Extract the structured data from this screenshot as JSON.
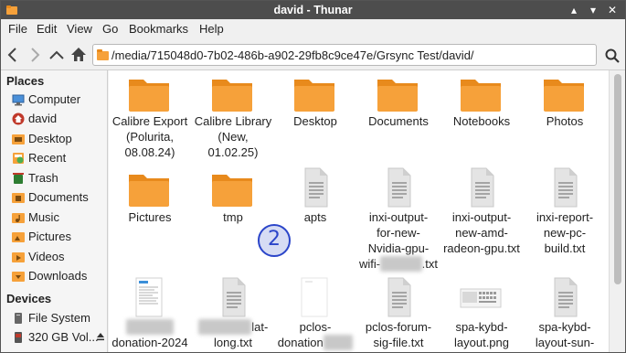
{
  "window": {
    "title": "david - Thunar"
  },
  "menubar": {
    "items": [
      "File",
      "Edit",
      "View",
      "Go",
      "Bookmarks",
      "Help"
    ]
  },
  "location": {
    "path": "/media/715048d0-7b02-486b-a902-29fb8c9ce47e/Grsync Test/david/"
  },
  "sidebar": {
    "places_header": "Places",
    "places": [
      {
        "label": "Computer",
        "icon": "computer-icon"
      },
      {
        "label": "david",
        "icon": "home-icon"
      },
      {
        "label": "Desktop",
        "icon": "desktop-folder-icon"
      },
      {
        "label": "Recent",
        "icon": "recent-icon"
      },
      {
        "label": "Trash",
        "icon": "trash-icon"
      },
      {
        "label": "Documents",
        "icon": "documents-folder-icon"
      },
      {
        "label": "Music",
        "icon": "music-folder-icon"
      },
      {
        "label": "Pictures",
        "icon": "pictures-folder-icon"
      },
      {
        "label": "Videos",
        "icon": "videos-folder-icon"
      },
      {
        "label": "Downloads",
        "icon": "downloads-folder-icon"
      }
    ],
    "devices_header": "Devices",
    "devices": [
      {
        "label": "File System",
        "icon": "drive-icon"
      },
      {
        "label": "320 GB Vol...",
        "icon": "removable-drive-icon"
      }
    ]
  },
  "files": [
    {
      "lines": [
        "Calibre Export",
        "(Polurita,",
        "08.08.24)"
      ],
      "type": "folder"
    },
    {
      "lines": [
        "Calibre Library",
        "(New, 01.02.25)"
      ],
      "type": "folder"
    },
    {
      "lines": [
        "Desktop"
      ],
      "type": "folder"
    },
    {
      "lines": [
        "Documents"
      ],
      "type": "folder"
    },
    {
      "lines": [
        "Notebooks"
      ],
      "type": "folder"
    },
    {
      "lines": [
        "Photos"
      ],
      "type": "folder"
    },
    {
      "lines": [
        "Pictures"
      ],
      "type": "folder"
    },
    {
      "lines": [
        "tmp"
      ],
      "type": "folder"
    },
    {
      "lines": [
        "apts"
      ],
      "type": "text"
    },
    {
      "lines": [
        "inxi-output-",
        "for-new-",
        "Nvidia-gpu-",
        "wifi-",
        ".txt"
      ],
      "type": "text"
    },
    {
      "lines": [
        "inxi-output-",
        "new-amd-",
        "radeon-gpu.txt"
      ],
      "type": "text"
    },
    {
      "lines": [
        "inxi-report-",
        "new-pc-",
        "build.txt"
      ],
      "type": "text"
    },
    {
      "lines": [
        "",
        "donation-2024"
      ],
      "type": "document-thumb"
    },
    {
      "lines": [
        "lat-",
        "long.txt"
      ],
      "type": "text"
    },
    {
      "lines": [
        "pclos-",
        "donation"
      ],
      "type": "blank-thumb"
    },
    {
      "lines": [
        "pclos-forum-",
        "sig-file.txt"
      ],
      "type": "text"
    },
    {
      "lines": [
        "spa-kybd-",
        "layout.png"
      ],
      "type": "image-thumb"
    },
    {
      "lines": [
        "spa-kybd-",
        "layout-sun-"
      ],
      "type": "text"
    }
  ],
  "annotation": {
    "label": "2"
  },
  "colors": {
    "folder": "#f6a13a",
    "folder_dark": "#e88a1c",
    "titlebar": "#4d4d4d",
    "badge": "#2b45c9"
  }
}
